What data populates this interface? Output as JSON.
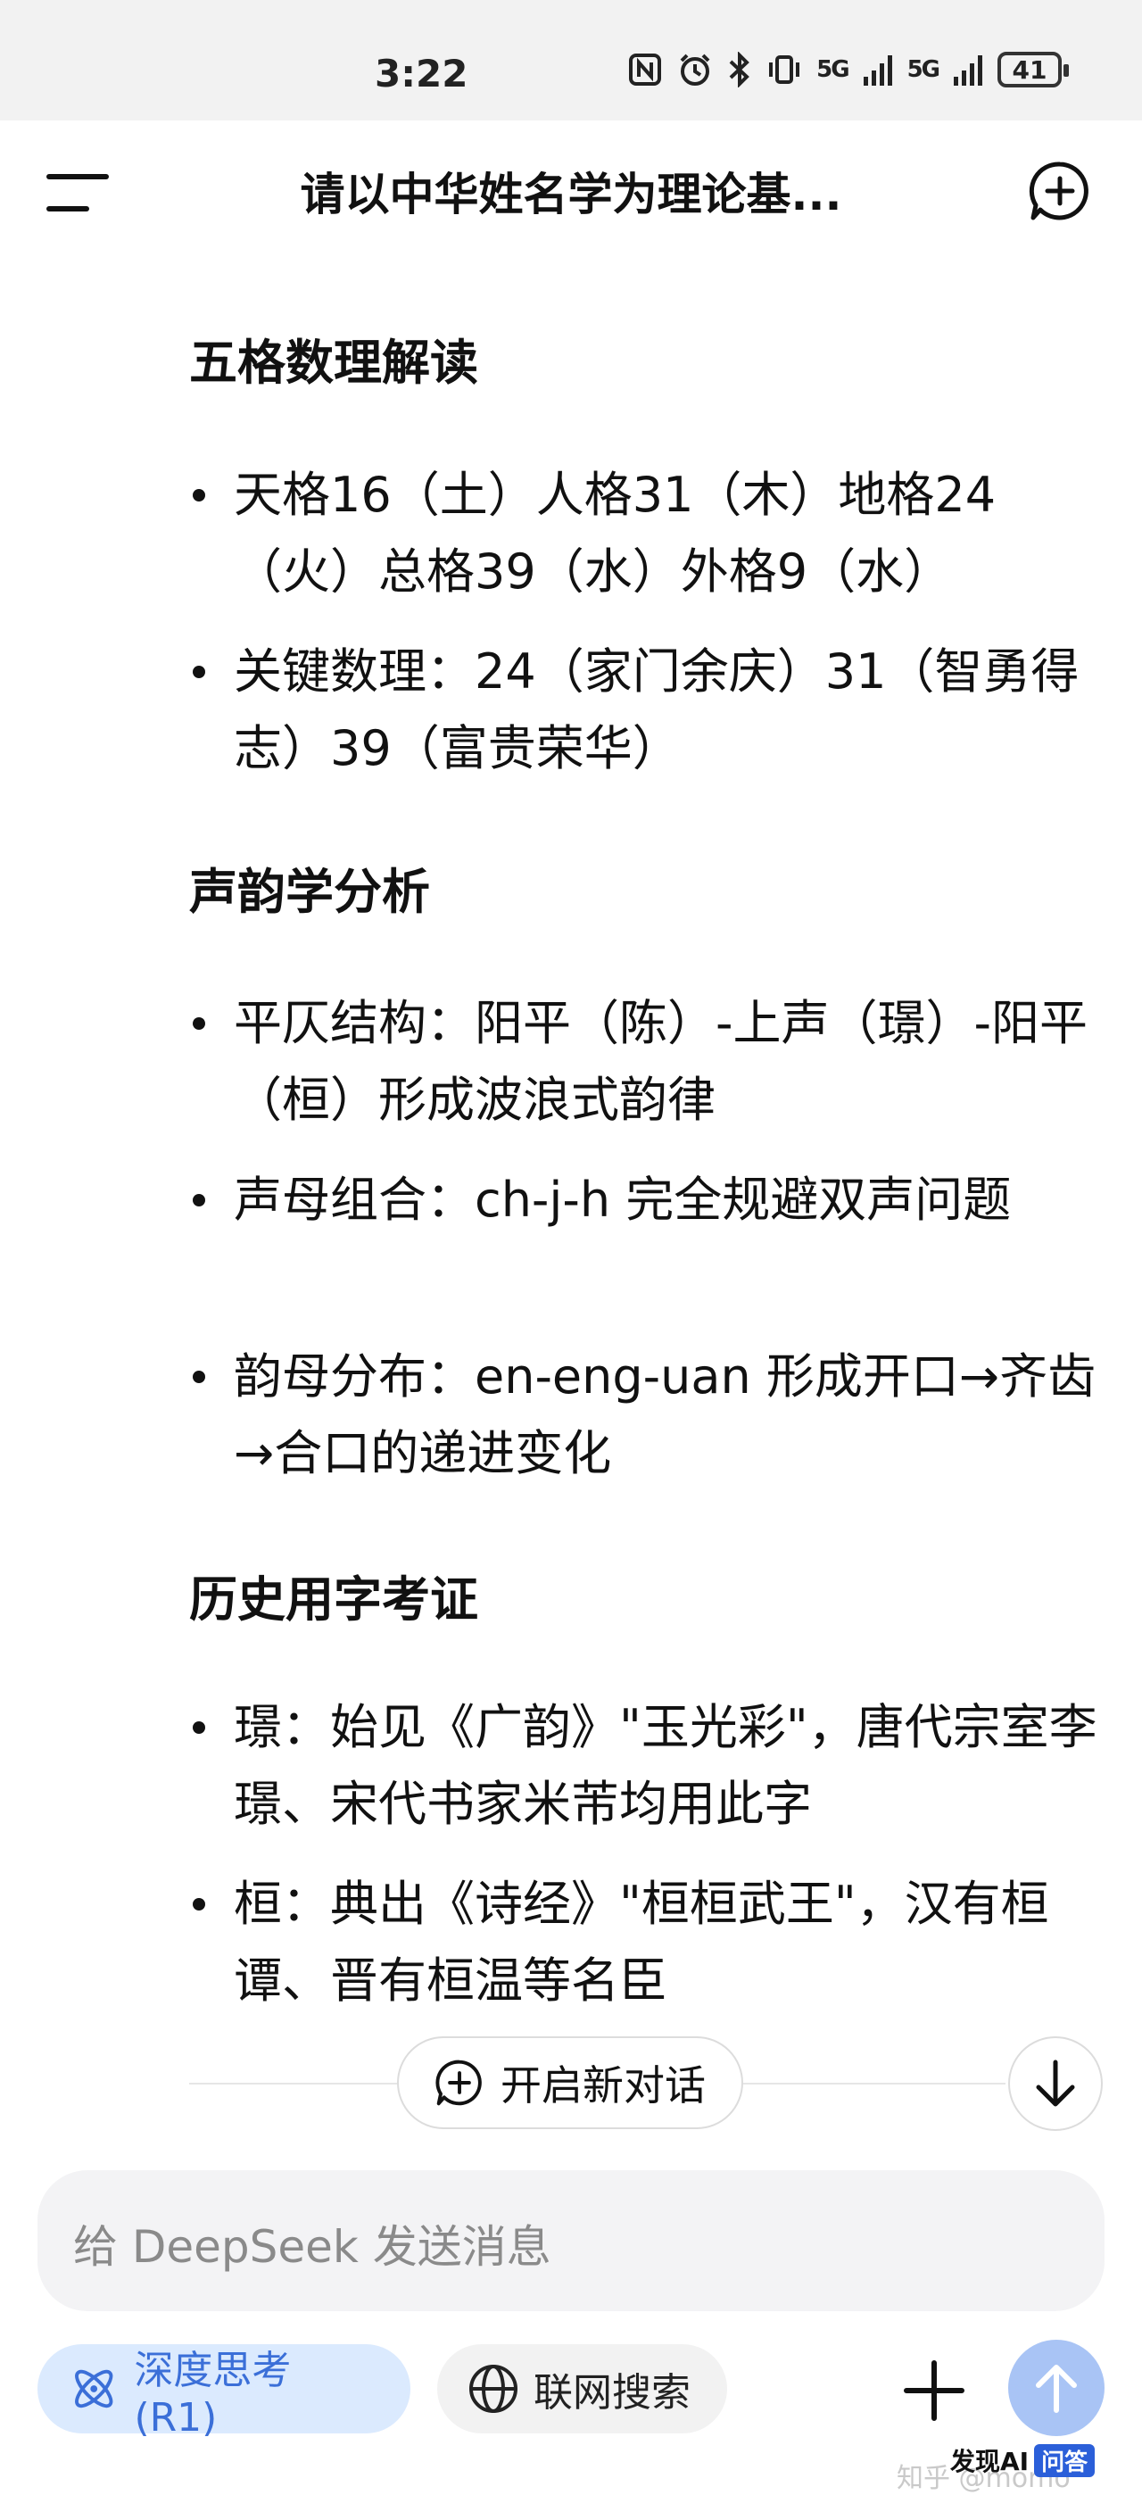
{
  "status_bar": {
    "time": "3:22",
    "icons": [
      "nfc-icon",
      "alarm-icon",
      "bluetooth-icon",
      "vibrate-icon",
      "signal-5g-icon",
      "signal-5g-icon"
    ],
    "signal_label": "5G",
    "battery": "41"
  },
  "header": {
    "title": "请以中华姓名学为理论基..."
  },
  "content": {
    "sections": [
      {
        "title": "五格数理解读",
        "bullets": [
          "天格16（土）人格31（木）地格24（火）总格39（水）外格9（水）",
          "关键数理：24（家门余庆）31（智勇得志）39（富贵荣华）"
        ]
      },
      {
        "title": "声韵学分析",
        "bullets": [
          "平仄结构：阳平（陈）-上声（璟）-阳平（桓）形成波浪式韵律",
          "声母组合：ch-j-h 完全规避双声问题",
          "韵母分布：en-eng-uan 形成开口→齐齿→合口的递进变化"
        ]
      },
      {
        "title": "历史用字考证",
        "bullets": [
          "璟：始见《广韵》\"玉光彩\"，唐代宗室李璟、宋代书家米芾均用此字",
          "桓：典出《诗经》\"桓桓武王\"，汉有桓谭、晋有桓温等名臣"
        ]
      }
    ]
  },
  "new_chat_button": {
    "label": "开启新对话"
  },
  "input": {
    "placeholder": "给 DeepSeek 发送消息"
  },
  "chips": {
    "deep_think": "深度思考 (R1)",
    "web_search": "联网搜索"
  },
  "watermark": "知乎 @momo",
  "brand": {
    "name": "发现AI",
    "tag": "问答"
  },
  "colors": {
    "accent": "#3b6fd8",
    "accent_bg": "#dbeafe",
    "send_bg": "#a9c4f5"
  }
}
